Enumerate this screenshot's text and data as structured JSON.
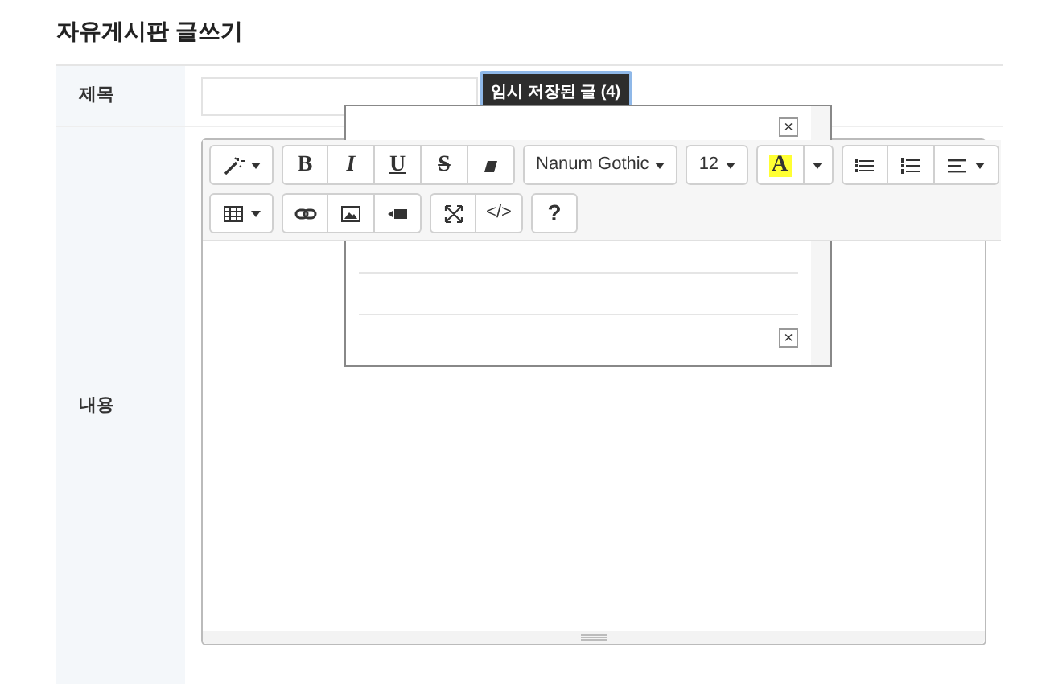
{
  "page_title": "자유게시판 글쓰기",
  "form": {
    "subject_label": "제목",
    "content_label": "내용",
    "temp_saved_button": "임시 저장된 글 (4)"
  },
  "popup": {
    "close": "×",
    "items": [
      {
        "delete": "×"
      }
    ]
  },
  "toolbar": {
    "top_row": {
      "groups": [
        {
          "buttons": [
            {
              "kind": "wand",
              "dropdown": true
            }
          ]
        },
        {
          "buttons": [
            {
              "kind": "bold",
              "text": "B"
            },
            {
              "kind": "italic",
              "text": "I"
            },
            {
              "kind": "underline",
              "text": "U"
            },
            {
              "kind": "strike",
              "text": "S"
            },
            {
              "kind": "eraser"
            }
          ]
        },
        {
          "buttons": [
            {
              "kind": "select",
              "text": "Nanum Gothic",
              "dropdown": true
            }
          ]
        },
        {
          "buttons": [
            {
              "kind": "select",
              "text": "12",
              "dropdown": true
            }
          ]
        },
        {
          "buttons": [
            {
              "kind": "highlight",
              "text": "A",
              "color": "#ffff33"
            },
            {
              "kind": "caret",
              "dropdown": true
            }
          ]
        },
        {
          "buttons": [
            {
              "kind": "bullets"
            },
            {
              "kind": "numbers"
            },
            {
              "kind": "align",
              "dropdown": true
            }
          ]
        }
      ]
    },
    "bottom_row": {
      "groups": [
        {
          "buttons": [
            {
              "kind": "table",
              "dropdown": true
            }
          ]
        },
        {
          "buttons": [
            {
              "kind": "link"
            },
            {
              "kind": "image"
            },
            {
              "kind": "video"
            }
          ]
        },
        {
          "buttons": [
            {
              "kind": "fullscreen"
            },
            {
              "kind": "code",
              "text": "</>"
            }
          ]
        },
        {
          "buttons": [
            {
              "kind": "help",
              "text": "?"
            }
          ]
        }
      ]
    }
  }
}
